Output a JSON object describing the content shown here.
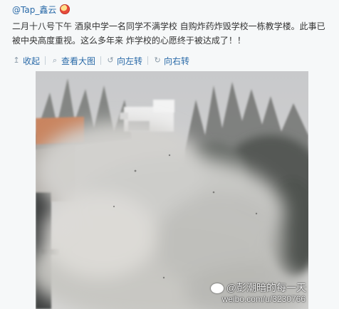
{
  "author": {
    "handle": "@Tap_鑫云"
  },
  "post": {
    "text": "二月十八号下午 酒泉中学一名同学不满学校 自购炸药炸毁学校一栋教学楼。此事已被中央高度重视。这么多年来 炸学校的心愿终于被达成了！！"
  },
  "actions": {
    "collapse": "收起",
    "view_large": "查看大图",
    "rotate_left": "向左转",
    "rotate_right": "向右转"
  },
  "watermark": {
    "user": "@彭潮暗的每一天",
    "url": "weibo.com/u/3230766"
  },
  "colors": {
    "link": "#2a6aa8",
    "text": "#333333",
    "background": "#f6f8f9"
  }
}
